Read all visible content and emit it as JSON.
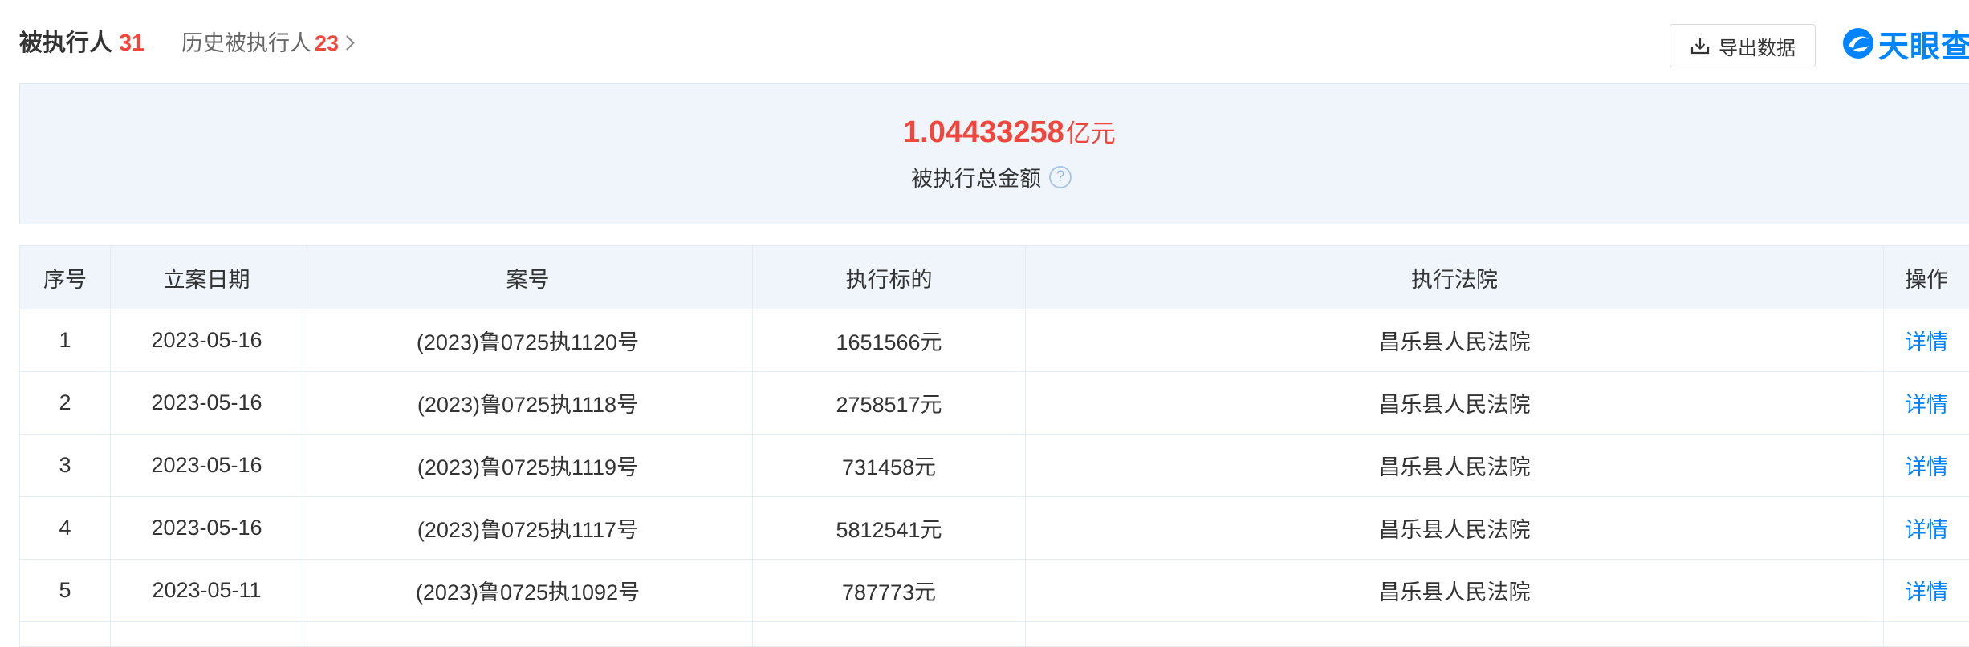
{
  "header": {
    "executed_label": "被执行人",
    "executed_count": "31",
    "history_label": "历史被执行人",
    "history_count": "23",
    "export_label": "导出数据",
    "logo_text": "天眼查"
  },
  "summary": {
    "amount_value": "1.04433258",
    "amount_unit": "亿元",
    "amount_label": "被执行总金额",
    "help_glyph": "?"
  },
  "table": {
    "columns": [
      "序号",
      "立案日期",
      "案号",
      "执行标的",
      "执行法院",
      "操作"
    ],
    "rows": [
      {
        "index": "1",
        "date": "2023-05-16",
        "case_no": "(2023)鲁0725执1120号",
        "amount": "1651566元",
        "court": "昌乐县人民法院",
        "action": "详情"
      },
      {
        "index": "2",
        "date": "2023-05-16",
        "case_no": "(2023)鲁0725执1118号",
        "amount": "2758517元",
        "court": "昌乐县人民法院",
        "action": "详情"
      },
      {
        "index": "3",
        "date": "2023-05-16",
        "case_no": "(2023)鲁0725执1119号",
        "amount": "731458元",
        "court": "昌乐县人民法院",
        "action": "详情"
      },
      {
        "index": "4",
        "date": "2023-05-16",
        "case_no": "(2023)鲁0725执1117号",
        "amount": "5812541元",
        "court": "昌乐县人民法院",
        "action": "详情"
      },
      {
        "index": "5",
        "date": "2023-05-11",
        "case_no": "(2023)鲁0725执1092号",
        "amount": "787773元",
        "court": "昌乐县人民法院",
        "action": "详情"
      }
    ]
  },
  "colors": {
    "accent": "#0084ff",
    "highlight": "#f0473c",
    "summary_bg": "#eff5fb"
  }
}
